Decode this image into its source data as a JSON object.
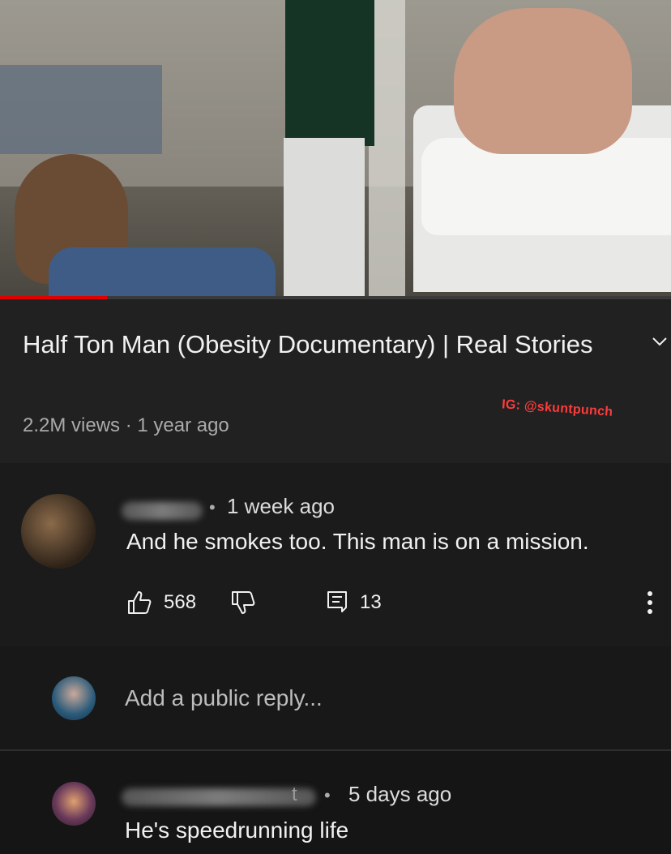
{
  "video": {
    "progress_percent": 16,
    "title": "Half Ton Man (Obesity Documentary) | Real Stories",
    "meta": "2.2M views · 1 year ago",
    "watermark": "IG: @skuntpunch"
  },
  "comment": {
    "separator": "•",
    "time": "1 week ago",
    "text": "And he smokes too. This man is on a mission.",
    "likes": "568",
    "replies": "13"
  },
  "reply_box": {
    "placeholder": "Add a public reply..."
  },
  "reply_comment": {
    "name_fragment": "t",
    "separator": "•",
    "time": "5 days ago",
    "text": "He's speedrunning life"
  },
  "icons": {
    "expand": "chevron-down-icon",
    "like": "thumbs-up-icon",
    "dislike": "thumbs-down-icon",
    "reply": "comment-icon",
    "more": "more-vertical-icon"
  },
  "colors": {
    "progress": "#e00000",
    "watermark": "#ff3b3b"
  }
}
